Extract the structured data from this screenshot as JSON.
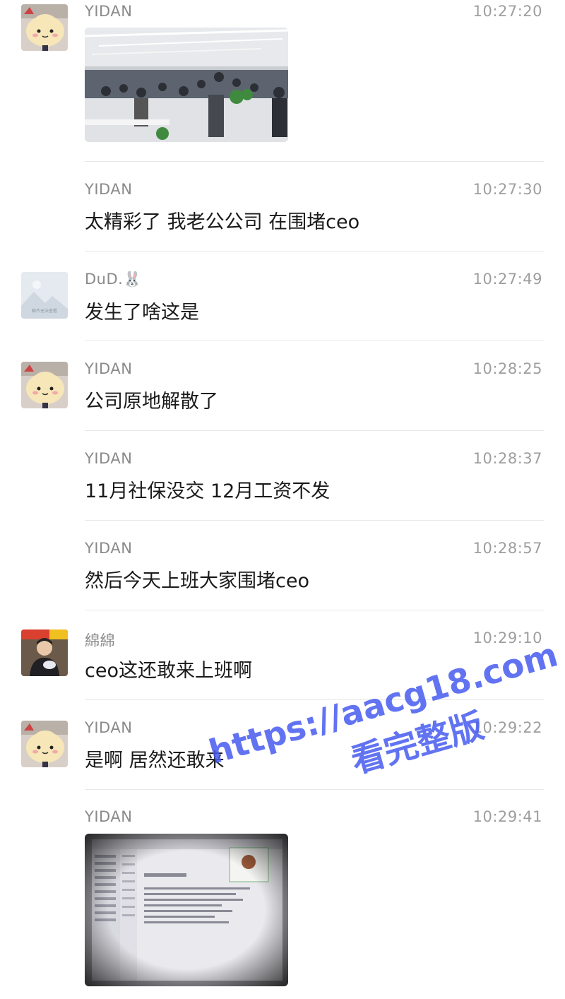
{
  "messages": [
    {
      "sender": "YIDAN",
      "time": "10:27:20",
      "text": "",
      "has_image": true,
      "image_desc": "office-crowd-photo"
    },
    {
      "sender": "YIDAN",
      "time": "10:27:30",
      "text": "太精彩了 我老公公司 在围堵ceo"
    },
    {
      "sender": "DuD.🐰",
      "time": "10:27:49",
      "text": "发生了啥这是"
    },
    {
      "sender": "YIDAN",
      "time": "10:28:25",
      "text": "公司原地解散了"
    },
    {
      "sender": "YIDAN",
      "time": "10:28:37",
      "text": "11月社保没交 12月工资不发"
    },
    {
      "sender": "YIDAN",
      "time": "10:28:57",
      "text": "然后今天上班大家围堵ceo"
    },
    {
      "sender": "綿綿",
      "time": "10:29:10",
      "text": "ceo这还敢来上班啊"
    },
    {
      "sender": "YIDAN",
      "time": "10:29:22",
      "text": "是啊 居然还敢来"
    },
    {
      "sender": "YIDAN",
      "time": "10:29:41",
      "text": "",
      "has_image": true,
      "image_desc": "screen-photo-meeting-notes"
    }
  ],
  "avatar_placeholder_text": "聊片无法查看",
  "watermark": {
    "line1": "https://aacg18.com",
    "line2": "看完整版"
  }
}
